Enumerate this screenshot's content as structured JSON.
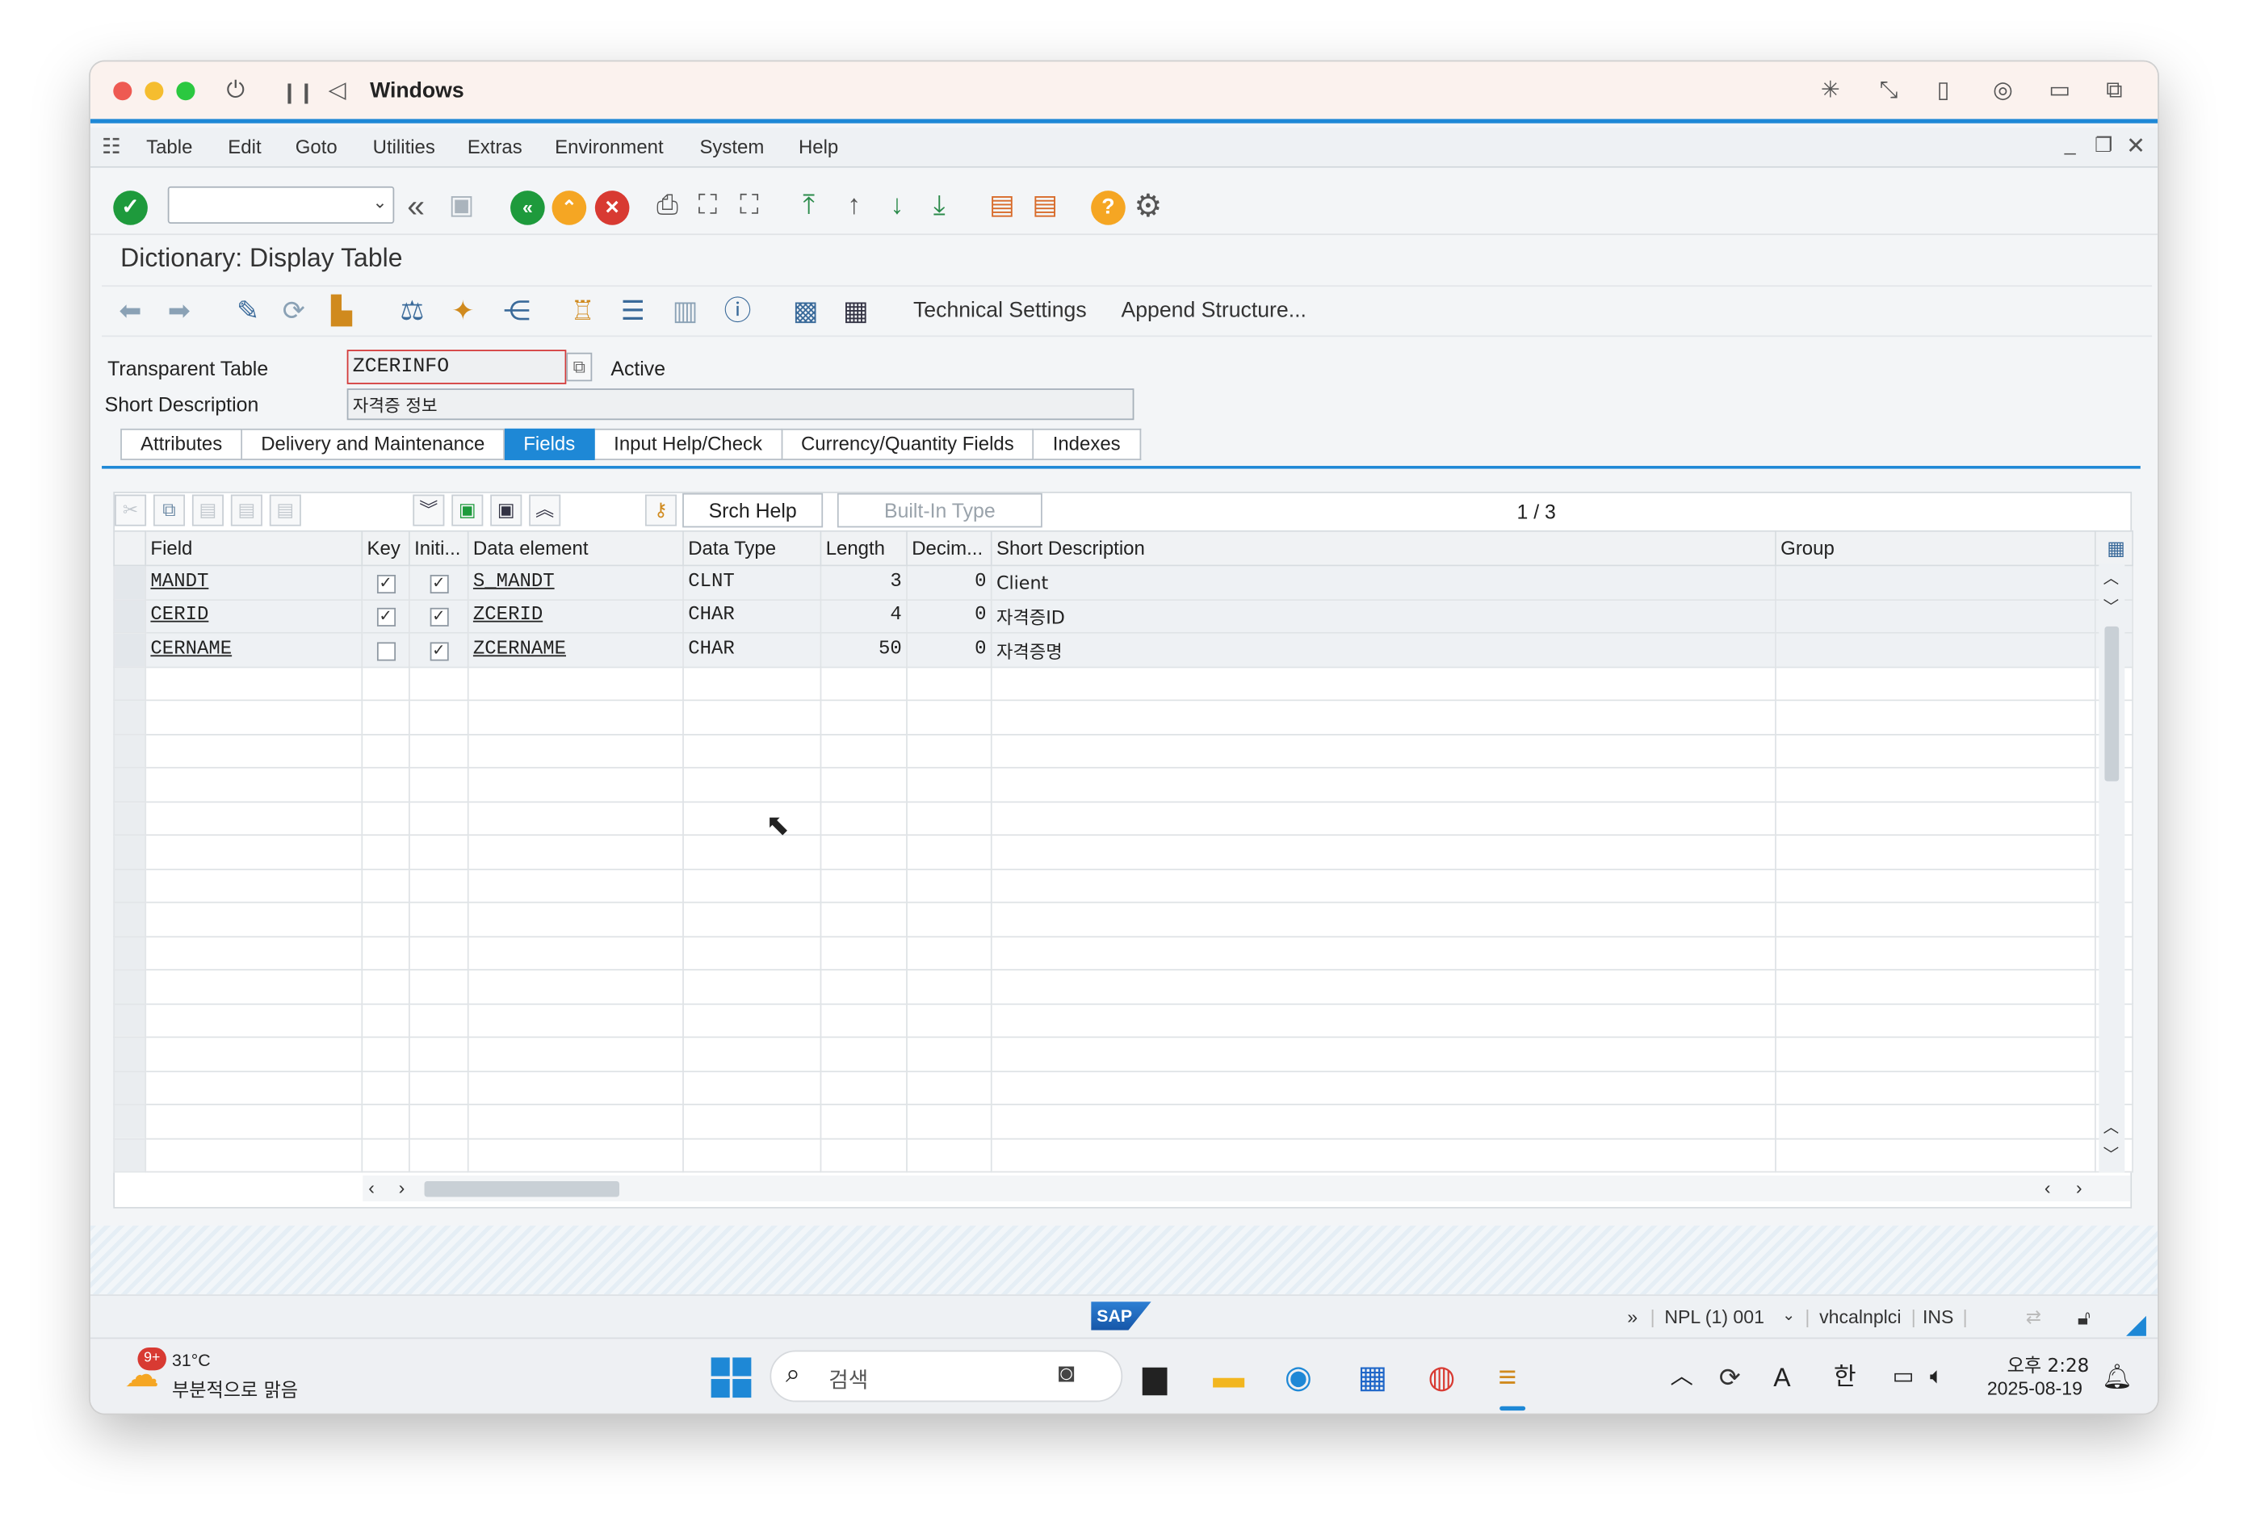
{
  "window": {
    "title": "Windows"
  },
  "menubar": {
    "items": [
      "Table",
      "Edit",
      "Goto",
      "Utilities",
      "Extras",
      "Environment",
      "System",
      "Help"
    ]
  },
  "page": {
    "title": "Dictionary: Display Table"
  },
  "app_toolbar": {
    "technical_settings": "Technical Settings",
    "append_structure": "Append Structure..."
  },
  "header": {
    "transparent_table_label": "Transparent Table",
    "transparent_table_value": "ZCERINFO",
    "status": "Active",
    "short_description_label": "Short Description",
    "short_description_value": "자격증 정보"
  },
  "tabs": [
    "Attributes",
    "Delivery and Maintenance",
    "Fields",
    "Input Help/Check",
    "Currency/Quantity Fields",
    "Indexes"
  ],
  "active_tab": "Fields",
  "fields_toolbar": {
    "srch_help": "Srch Help",
    "built_in_type": "Built-In Type",
    "pager": "1 / 3"
  },
  "grid": {
    "columns": [
      "Field",
      "Key",
      "Initi...",
      "Data element",
      "Data Type",
      "Length",
      "Decim...",
      "Short Description",
      "Group"
    ],
    "rows": [
      {
        "field": "MANDT",
        "key": true,
        "initial": true,
        "data_element": "S_MANDT",
        "data_type": "CLNT",
        "length": "3",
        "decimals": "0",
        "short_description": "Client",
        "group": ""
      },
      {
        "field": "CERID",
        "key": true,
        "initial": true,
        "data_element": "ZCERID",
        "data_type": "CHAR",
        "length": "4",
        "decimals": "0",
        "short_description": "자격증ID",
        "group": ""
      },
      {
        "field": "CERNAME",
        "key": false,
        "initial": true,
        "data_element": "ZCERNAME",
        "data_type": "CHAR",
        "length": "50",
        "decimals": "0",
        "short_description": "자격증명",
        "group": ""
      }
    ]
  },
  "statusbar": {
    "system": "NPL (1) 001",
    "server": "vhcalnplci",
    "mode": "INS",
    "logo": "SAP"
  },
  "taskbar": {
    "temperature": "31°C",
    "weather": "부분적으로 맑음",
    "badge": "9+",
    "search_placeholder": "검색",
    "time": "오후 2:28",
    "date": "2025-08-19",
    "ime_a": "A",
    "ime_lang": "한"
  },
  "colors": {
    "accent": "#1e88d6",
    "ok": "#1e9a3c",
    "cancel": "#d83a32",
    "up": "#f5a623"
  }
}
